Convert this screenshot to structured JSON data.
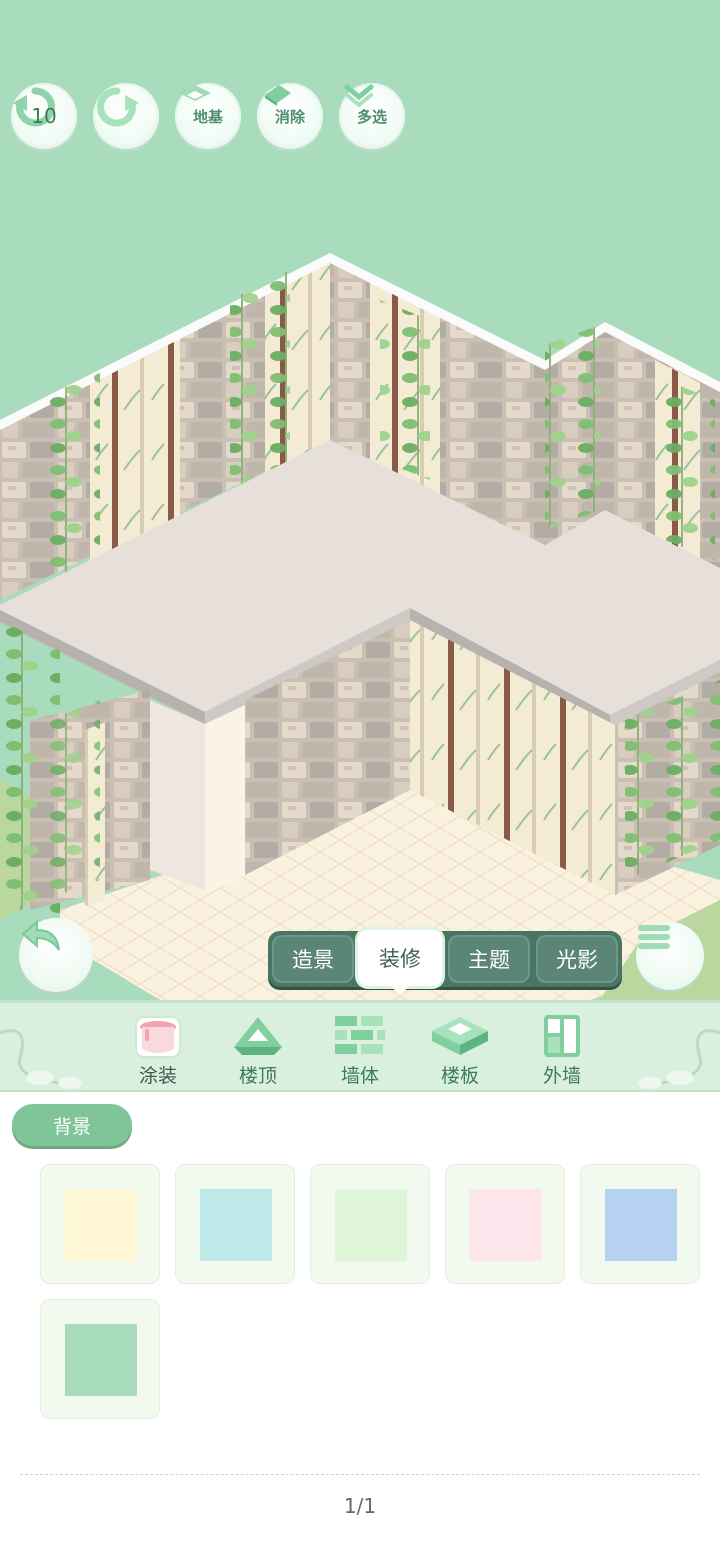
{
  "toolbar": {
    "undo_count": "10",
    "foundation_label": "地基",
    "erase_label": "消除",
    "multi_select_label": "多选"
  },
  "mode_tabs": [
    {
      "label": "造景",
      "active": false
    },
    {
      "label": "装修",
      "active": true
    },
    {
      "label": "主题",
      "active": false
    },
    {
      "label": "光影",
      "active": false
    }
  ],
  "categories": [
    {
      "label": "涂装",
      "icon": "paint-bucket-icon",
      "active": true
    },
    {
      "label": "楼顶",
      "icon": "roof-icon",
      "active": false
    },
    {
      "label": "墙体",
      "icon": "brick-wall-icon",
      "active": false
    },
    {
      "label": "楼板",
      "icon": "floor-slab-icon",
      "active": false
    },
    {
      "label": "外墙",
      "icon": "exterior-wall-icon",
      "active": false
    }
  ],
  "filter": {
    "label": "背景"
  },
  "swatches": [
    {
      "color": "#fff6d6"
    },
    {
      "color": "#bde9e9"
    },
    {
      "color": "#dff5d8"
    },
    {
      "color": "#fde5ec"
    },
    {
      "color": "#b5d3f0"
    },
    {
      "color": "#a9dcbc"
    }
  ],
  "pagination": {
    "text": "1/1"
  },
  "colors": {
    "scene_background": "#a9dcbc",
    "accent_green": "#80c598",
    "tab_dark": "#497563"
  }
}
